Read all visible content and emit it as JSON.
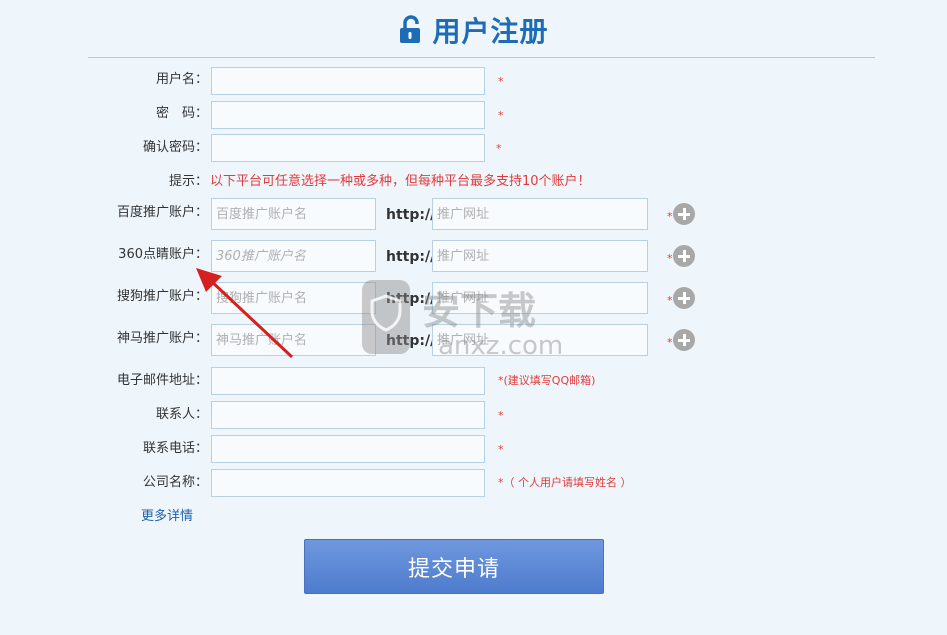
{
  "header": {
    "title": "用户注册",
    "icon": "unlock-icon"
  },
  "fields": {
    "username": {
      "label": "用户名：",
      "value": ""
    },
    "password": {
      "label": "密　码：",
      "value": ""
    },
    "confirm": {
      "label": "确认密码：",
      "value": ""
    }
  },
  "required_mark": "*",
  "tip": {
    "label": "提示：",
    "text": "以下平台可任意选择一种或多种，但每种平台最多支持10个账户！"
  },
  "platforms": {
    "baidu": {
      "label": "百度推广账户：",
      "placeholder": "百度推广账户名",
      "url_placeholder": "推广网址"
    },
    "p360": {
      "label": "360点睛账户：",
      "placeholder": "360推广账户名",
      "url_placeholder": "推广网址"
    },
    "sogou": {
      "label": "搜狗推广账户：",
      "placeholder": "搜狗推广账户名",
      "url_placeholder": "推广网址"
    },
    "shenma": {
      "label": "神马推广账户：",
      "placeholder": "神马推广账户名",
      "url_placeholder": "推广网址"
    }
  },
  "http_prefix": "http://",
  "contact": {
    "email": {
      "label": "电子邮件地址：",
      "hint": "*(建议填写QQ邮箱)"
    },
    "person": {
      "label": "联系人："
    },
    "phone": {
      "label": "联系电话："
    },
    "company": {
      "label": "公司名称：",
      "hint": "*（ 个人用户请填写姓名 ）"
    }
  },
  "more_link": "更多详情",
  "submit_label": "提交申请",
  "watermark": {
    "text": "安下载",
    "domain": "anxz.com"
  },
  "colors": {
    "title": "#1d6cb5",
    "required": "#e23b3b",
    "submit": "#5a86d3",
    "background": "#eef6fc"
  }
}
